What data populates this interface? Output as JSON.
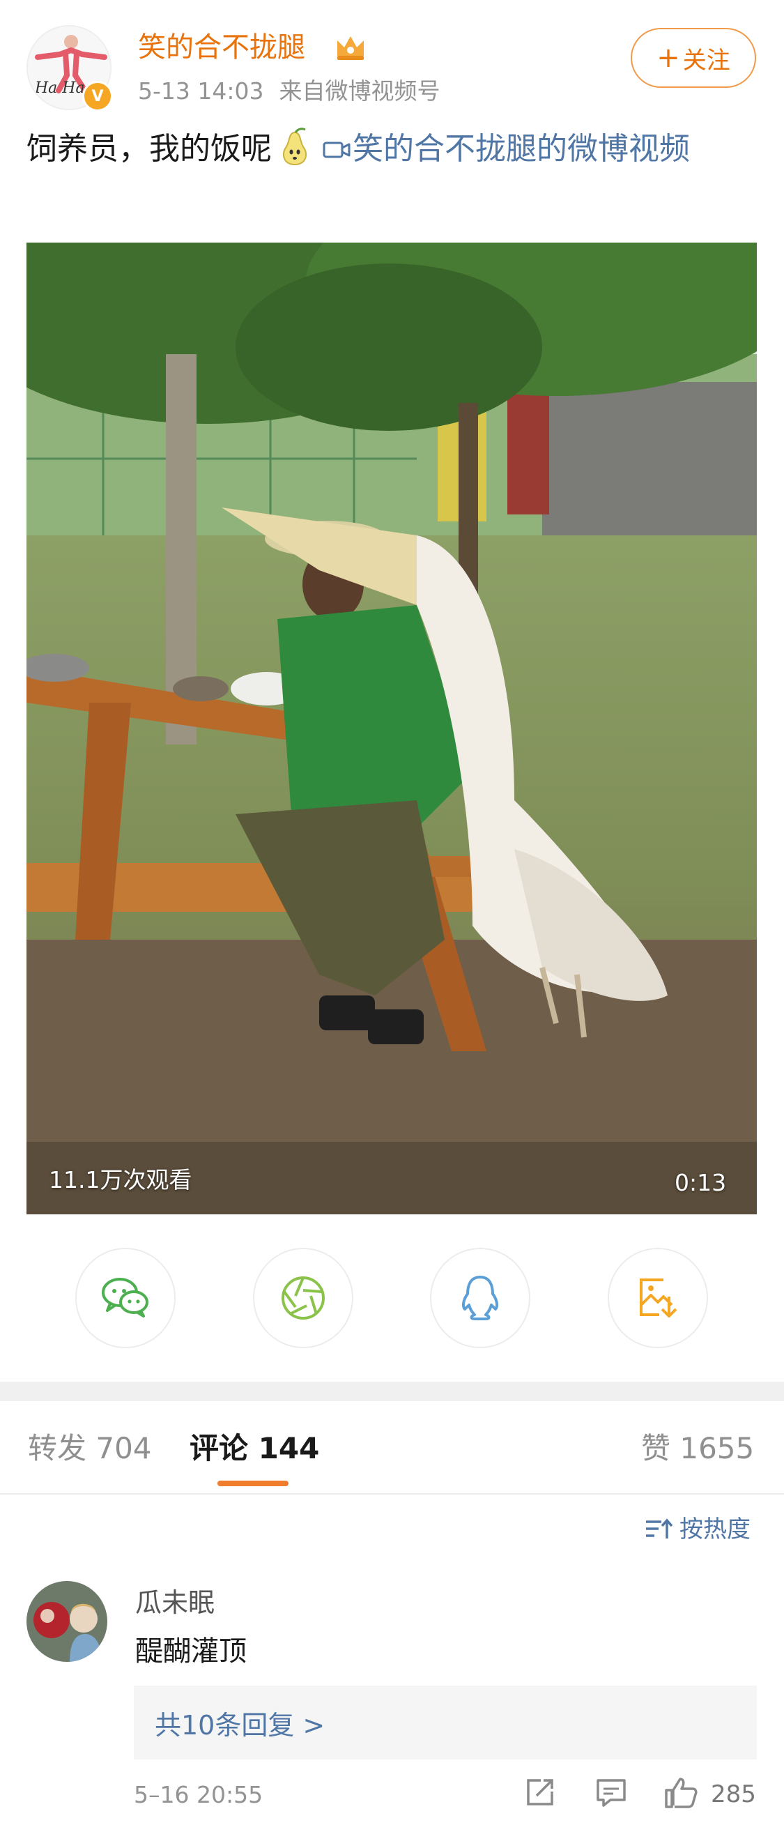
{
  "post": {
    "author": "笑的合不拢腿",
    "time": "5-13 14:03",
    "source": "来自微博视频号",
    "follow_label": "关注",
    "text": "饲养员，我的饭呢",
    "video_link": "笑的合不拢腿的微博视频",
    "avatar_text": "Ha Ha"
  },
  "video": {
    "views": "11.1万次观看",
    "duration": "0:13"
  },
  "share": {
    "items": [
      "wechat",
      "moments",
      "qq",
      "save-image"
    ]
  },
  "tabs": {
    "repost": "转发 704",
    "comment": "评论 144",
    "like": "赞 1655"
  },
  "sort_label": "按热度",
  "comment": {
    "user": "瓜未眠",
    "text": "醍醐灌顶",
    "replies": "共10条回复 >",
    "time": "5–16 20:55",
    "likes": "285"
  },
  "colors": {
    "accent": "#ef7d2d",
    "link": "#5076a6",
    "username": "#e8730d",
    "meta": "#939393"
  }
}
